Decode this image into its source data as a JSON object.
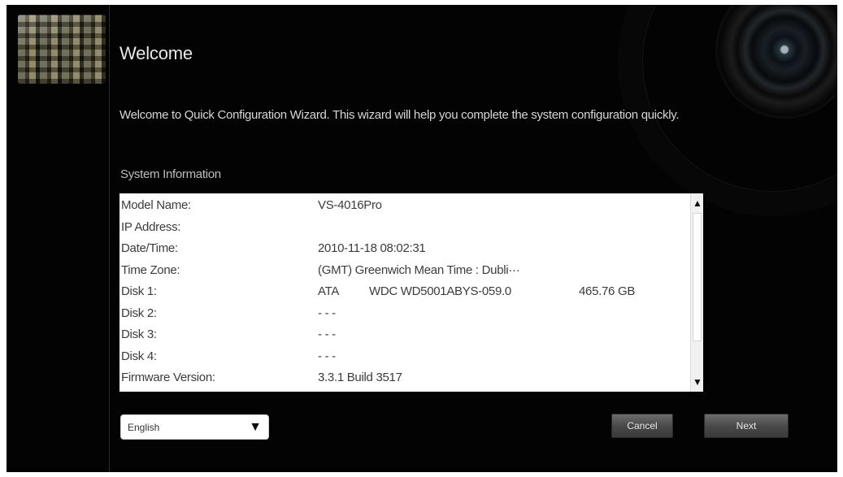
{
  "header": {
    "title": "Welcome"
  },
  "intro_text": "Welcome to Quick Configuration Wizard.  This wizard will help you complete the system configuration quickly.",
  "system_info": {
    "heading": "System Information",
    "rows": [
      {
        "label": "Model Name:",
        "value": "VS-4016Pro"
      },
      {
        "label": "IP Address:",
        "value": ""
      },
      {
        "label": "Date/Time:",
        "value": "2010-11-18 08:02:31"
      },
      {
        "label": "Time Zone:",
        "value": "(GMT) Greenwich Mean Time : Dubli···"
      },
      {
        "label": "Disk 1:",
        "value": "",
        "parts": [
          "ATA",
          "WDC WD5001ABYS-059.0",
          "465.76 GB"
        ]
      },
      {
        "label": "Disk 2:",
        "value": "- - -"
      },
      {
        "label": "Disk 3:",
        "value": "- - -"
      },
      {
        "label": "Disk 4:",
        "value": "- - -"
      },
      {
        "label": "Firmware Version:",
        "value": "3.3.1 Build 3517"
      }
    ]
  },
  "scrollbar": {
    "up_icon": "arrow-up-icon",
    "down_icon": "arrow-down-icon"
  },
  "language_select": {
    "selected": "English",
    "icon": "dropdown-arrow-icon"
  },
  "buttons": {
    "cancel_label": "Cancel",
    "next_label": "Next"
  }
}
